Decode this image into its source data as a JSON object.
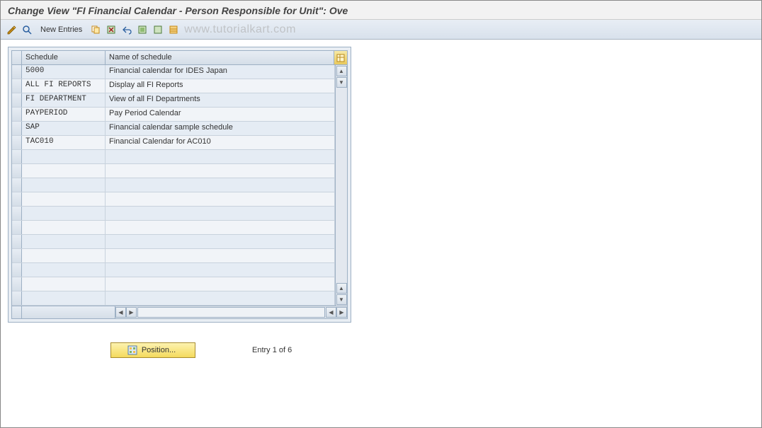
{
  "title": "Change View \"FI Financial Calendar - Person Responsible for Unit\": Ove",
  "toolbar": {
    "new_entries_label": "New Entries"
  },
  "watermark": "www.tutorialkart.com",
  "table": {
    "headers": {
      "schedule": "Schedule",
      "name": "Name of schedule"
    },
    "rows": [
      {
        "schedule": "5000",
        "name": "Financial calendar for IDES Japan"
      },
      {
        "schedule": "ALL FI REPORTS",
        "name": "Display all FI Reports"
      },
      {
        "schedule": "FI DEPARTMENT",
        "name": "View of all FI Departments"
      },
      {
        "schedule": "PAYPERIOD",
        "name": "Pay Period Calendar"
      },
      {
        "schedule": "SAP",
        "name": "Financial calendar sample schedule"
      },
      {
        "schedule": "TAC010",
        "name": "Financial Calendar for AC010"
      },
      {
        "schedule": "",
        "name": ""
      },
      {
        "schedule": "",
        "name": ""
      },
      {
        "schedule": "",
        "name": ""
      },
      {
        "schedule": "",
        "name": ""
      },
      {
        "schedule": "",
        "name": ""
      },
      {
        "schedule": "",
        "name": ""
      },
      {
        "schedule": "",
        "name": ""
      },
      {
        "schedule": "",
        "name": ""
      },
      {
        "schedule": "",
        "name": ""
      },
      {
        "schedule": "",
        "name": ""
      },
      {
        "schedule": "",
        "name": ""
      }
    ]
  },
  "footer": {
    "position_label": "Position...",
    "entry_label": "Entry 1 of 6"
  }
}
